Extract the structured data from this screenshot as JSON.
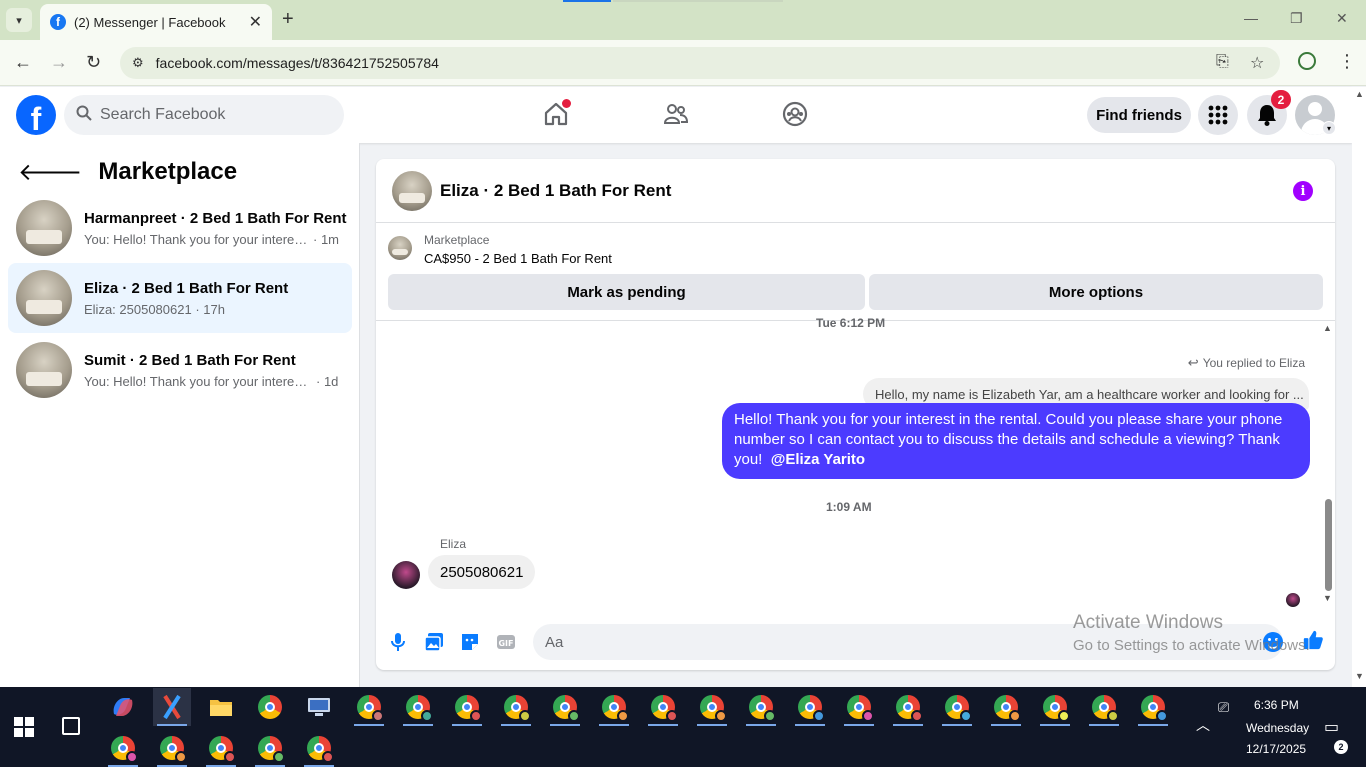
{
  "browser": {
    "tab_title": "(2) Messenger | Facebook",
    "url": "facebook.com/messages/t/836421752505784",
    "tab_close": "✕",
    "new_tab": "+",
    "minimize": "—",
    "restore": "❐",
    "close": "✕"
  },
  "header": {
    "logo_letter": "f",
    "search_placeholder": "Search Facebook",
    "find_friends": "Find friends",
    "notification_count": "2"
  },
  "sidebar": {
    "title": "Marketplace",
    "conversations": [
      {
        "name": "Harmanpreet · 2 Bed 1 Bath For Rent",
        "snippet": "You: Hello! Thank you for your interest in the rental. Could you please share",
        "time": "· 1m"
      },
      {
        "name": "Eliza · 2 Bed 1 Bath For Rent",
        "snippet": "Eliza: 2505080621",
        "time": " · 17h"
      },
      {
        "name": "Sumit · 2 Bed 1 Bath For Rent",
        "snippet": "You: Hello! Thank you for your interest in the rental. Could you please share",
        "time": "· 1d"
      }
    ]
  },
  "chat": {
    "title": "Eliza · 2 Bed 1 Bath For Rent",
    "listing_label": "Marketplace",
    "listing_price": "CA$950 - 2 Bed 1 Bath For Rent",
    "mark_pending": "Mark as pending",
    "more_options": "More options",
    "timestamp_top": "Tue 6:12 PM",
    "replied_label": "You replied to Eliza",
    "quoted_text": "Hello, my name is Elizabeth Yar, am a healthcare worker and looking for ...",
    "outgoing_text": "Hello! Thank you for your interest in the rental. Could you please share your phone number so I can contact you to discuss the details and schedule a viewing? Thank you!",
    "outgoing_mention": "@Eliza Yarito",
    "timestamp_mid": "1:09 AM",
    "sender_name": "Eliza",
    "incoming_text": "2505080621",
    "composer_placeholder": "Aa"
  },
  "watermark": {
    "line1": "Activate Windows",
    "line2": "Go to Settings to activate Windows."
  },
  "taskbar": {
    "time": "6:36 PM",
    "day": "Wednesday",
    "date": "12/17/2025",
    "notification_count": "2"
  },
  "colors": {
    "fb_blue": "#0866ff",
    "outgoing_bubble": "#4c3bff",
    "active_conversation": "#ebf5ff",
    "badge_red": "#e41e3f",
    "info_purple": "#a100ff"
  }
}
